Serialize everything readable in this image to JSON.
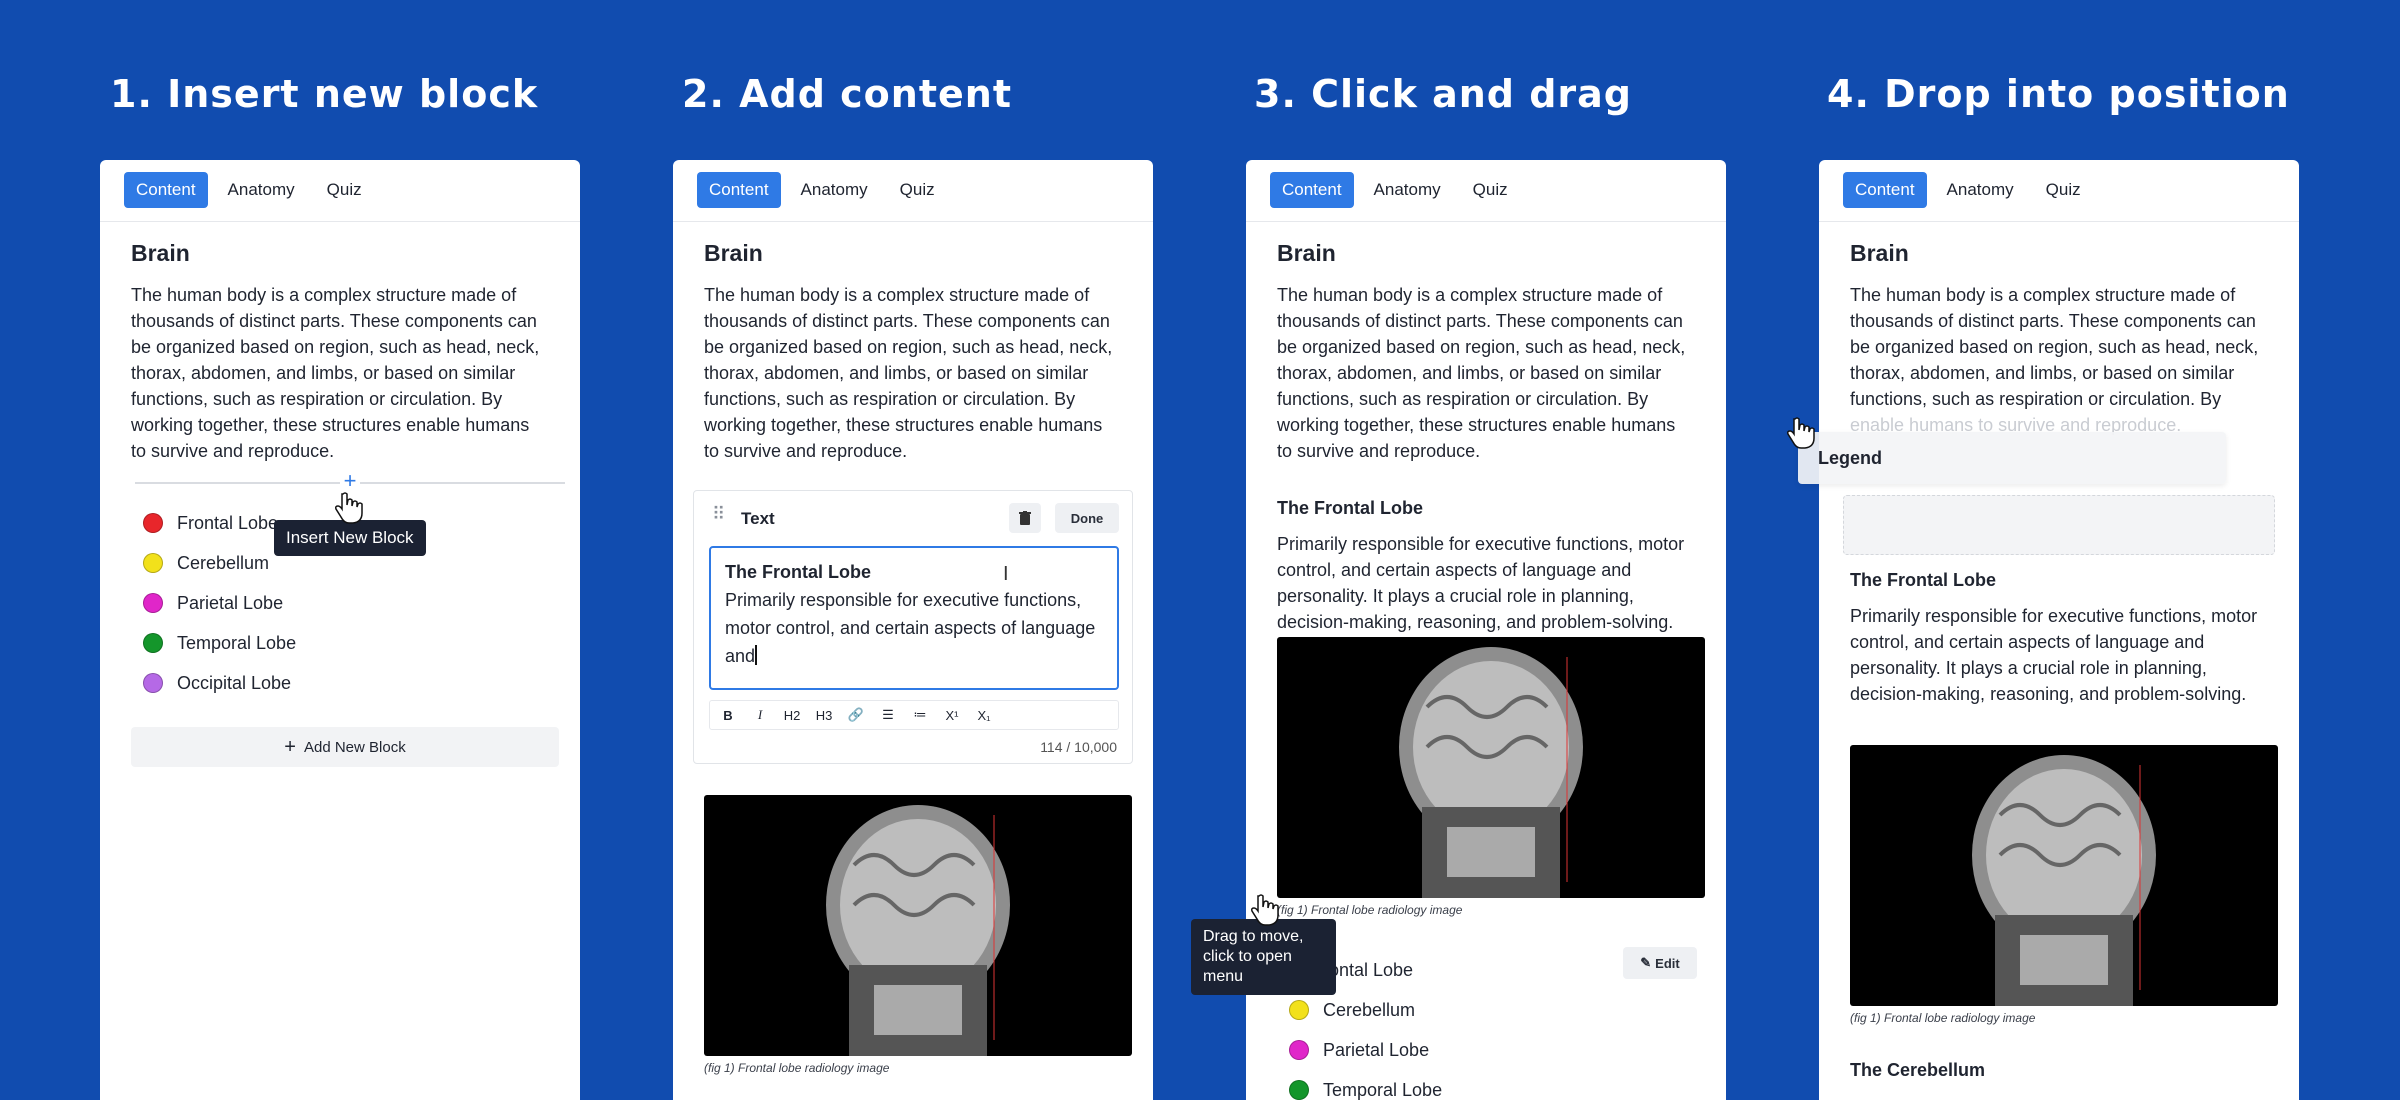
{
  "steps": [
    {
      "title": "1.  Insert new block"
    },
    {
      "title": "2. Add content"
    },
    {
      "title": "3. Click and drag"
    },
    {
      "title": "4. Drop into position"
    }
  ],
  "tabs": [
    "Content",
    "Anatomy",
    "Quiz"
  ],
  "heading": "Brain",
  "paragraph": "The human body is a complex structure made of thousands of distinct parts. These components can be organized based on region, such as head, neck, thorax, abdomen, and limbs, or based on similar functions, such as respiration or circulation. By working together, these structures enable humans to survive and reproduce.",
  "legend_items": [
    {
      "label": "Frontal Lobe",
      "color": "#e8262b"
    },
    {
      "label": "Cerebellum",
      "color": "#f2e11b"
    },
    {
      "label": "Parietal Lobe",
      "color": "#e026c9"
    },
    {
      "label": "Temporal Lobe",
      "color": "#14962b"
    },
    {
      "label": "Occipital Lobe",
      "color": "#b569e6"
    }
  ],
  "panel1": {
    "insert_tooltip": "Insert New Block",
    "add_block_label": "Add New Block",
    "plus_glyph": "+"
  },
  "panel2": {
    "block_type": "Text",
    "done_label": "Done",
    "editor_heading": "The Frontal Lobe",
    "editor_text": "Primarily responsible for executive functions, motor control, and certain aspects of language and",
    "toolbar": [
      "B",
      "I",
      "H2",
      "H3",
      "link-icon",
      "ordered-list-icon",
      "bullet-list-icon",
      "X¹",
      "X₁"
    ],
    "char_count": "114 / 10,000",
    "caption": "(fig 1) Frontal lobe radiology image"
  },
  "panel3": {
    "section_heading": "The Frontal Lobe",
    "section_text": "Primarily responsible for executive functions, motor control, and certain aspects of language and personality. It plays a crucial role in planning, decision-making, reasoning, and problem-solving.",
    "caption": "(fig 1) Frontal lobe radiology image",
    "drag_tooltip": "Drag to move, click to open menu",
    "edit_label": "Edit",
    "legend_partial": [
      "rontal Lobe",
      "Cerebellum",
      "Parietal Lobe",
      "Temporal Lobe"
    ]
  },
  "panel4": {
    "legend_label": "Legend",
    "ghost_text": "enable humans to survive and reproduce.",
    "section_heading": "The Frontal Lobe",
    "section_text": "Primarily responsible for executive functions, motor control, and certain aspects of language and personality. It plays a crucial role in planning, decision-making, reasoning, and problem-solving.",
    "caption": "(fig 1) Frontal lobe radiology image",
    "next_heading": "The Cerebellum"
  }
}
